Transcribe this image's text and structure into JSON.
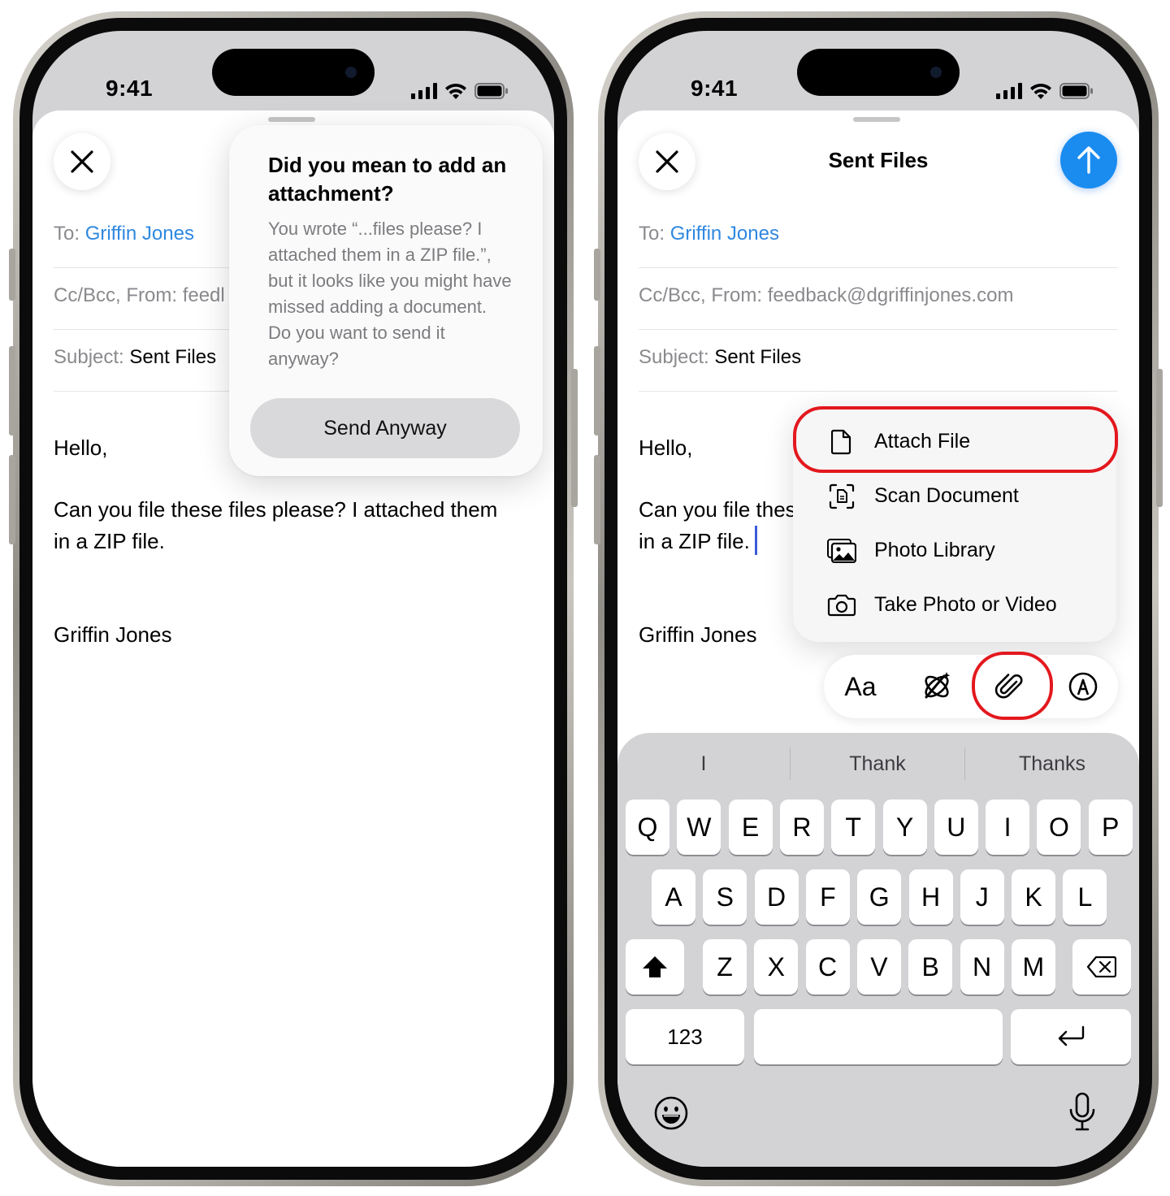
{
  "status": {
    "time": "9:41"
  },
  "left": {
    "to_label": "To:",
    "to_name": "Griffin Jones",
    "cc_label": "Cc/Bcc, From:",
    "cc_value": "feedl",
    "subject_label": "Subject:",
    "subject_value": "Sent Files",
    "body_greeting": "Hello,",
    "body_line1": "Can you file these files please? I attached them",
    "body_line2": "in a ZIP file.",
    "signature": "Griffin Jones",
    "popover": {
      "title": "Did you mean to add an attachment?",
      "body": "You wrote “...files please? I attached them in a ZIP file.”, but it looks like you might have missed adding a document. Do you want to send it anyway?",
      "button": "Send Anyway"
    }
  },
  "right": {
    "title": "Sent Files",
    "to_label": "To:",
    "to_name": "Griffin Jones",
    "cc_label": "Cc/Bcc, From:",
    "cc_value": "feedback@dgriffinjones.com",
    "subject_label": "Subject:",
    "subject_value": "Sent Files",
    "body_greeting": "Hello,",
    "body_line1": "Can you file thes",
    "body_line2": "in a ZIP file.",
    "signature": "Griffin Jones",
    "menu": [
      {
        "label": "Attach File",
        "icon": "document-icon"
      },
      {
        "label": "Scan Document",
        "icon": "scan-document-icon"
      },
      {
        "label": "Photo Library",
        "icon": "photo-library-icon"
      },
      {
        "label": "Take Photo or Video",
        "icon": "camera-icon"
      }
    ],
    "toolbar": {
      "format_label": "Aa"
    },
    "suggestions": [
      "I",
      "Thank",
      "Thanks"
    ],
    "keyboard": {
      "row1": [
        "Q",
        "W",
        "E",
        "R",
        "T",
        "Y",
        "U",
        "I",
        "O",
        "P"
      ],
      "row2": [
        "A",
        "S",
        "D",
        "F",
        "G",
        "H",
        "J",
        "K",
        "L"
      ],
      "row3": [
        "Z",
        "X",
        "C",
        "V",
        "B",
        "N",
        "M"
      ],
      "numbers_label": "123"
    }
  },
  "colors": {
    "accent": "#1a8cf0",
    "link": "#2f88e0",
    "highlight": "#e3181e"
  }
}
